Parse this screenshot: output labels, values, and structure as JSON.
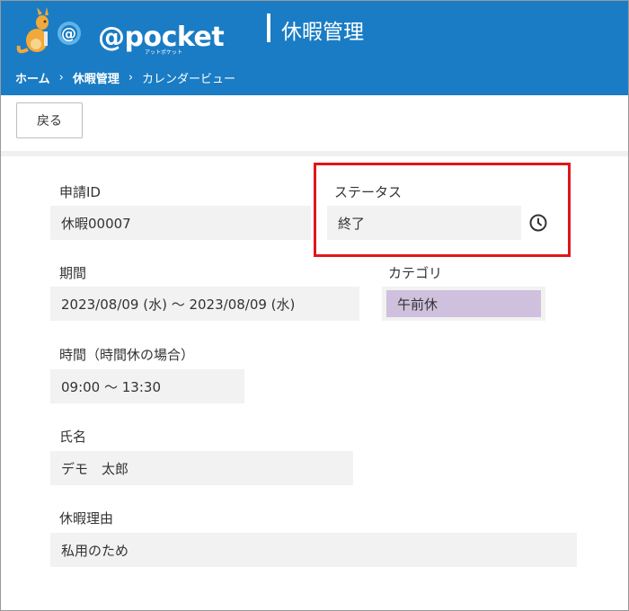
{
  "header": {
    "logo_text": "@pocket",
    "logo_sub": "アットポケット",
    "app_title": "休暇管理",
    "bg_color": "#1a7cc4"
  },
  "breadcrumb": {
    "items": [
      "ホーム",
      "休暇管理",
      "カレンダービュー"
    ],
    "separator": "›"
  },
  "toolbar": {
    "back_label": "戻る"
  },
  "form": {
    "request_id": {
      "label": "申請ID",
      "value": "休暇00007"
    },
    "status": {
      "label": "ステータス",
      "value": "終了",
      "icon": "clock-icon"
    },
    "period": {
      "label": "期間",
      "value": "2023/08/09 (水) ～ 2023/08/09 (水)"
    },
    "category": {
      "label": "カテゴリ",
      "value": "午前休",
      "color": "#cfc0dd"
    },
    "time": {
      "label": "時間（時間休の場合）",
      "value": "09:00 ～ 13:30"
    },
    "name": {
      "label": "氏名",
      "value": "デモ　太郎"
    },
    "reason": {
      "label": "休暇理由",
      "value": "私用のため"
    }
  },
  "highlight_color": "#e0161b"
}
